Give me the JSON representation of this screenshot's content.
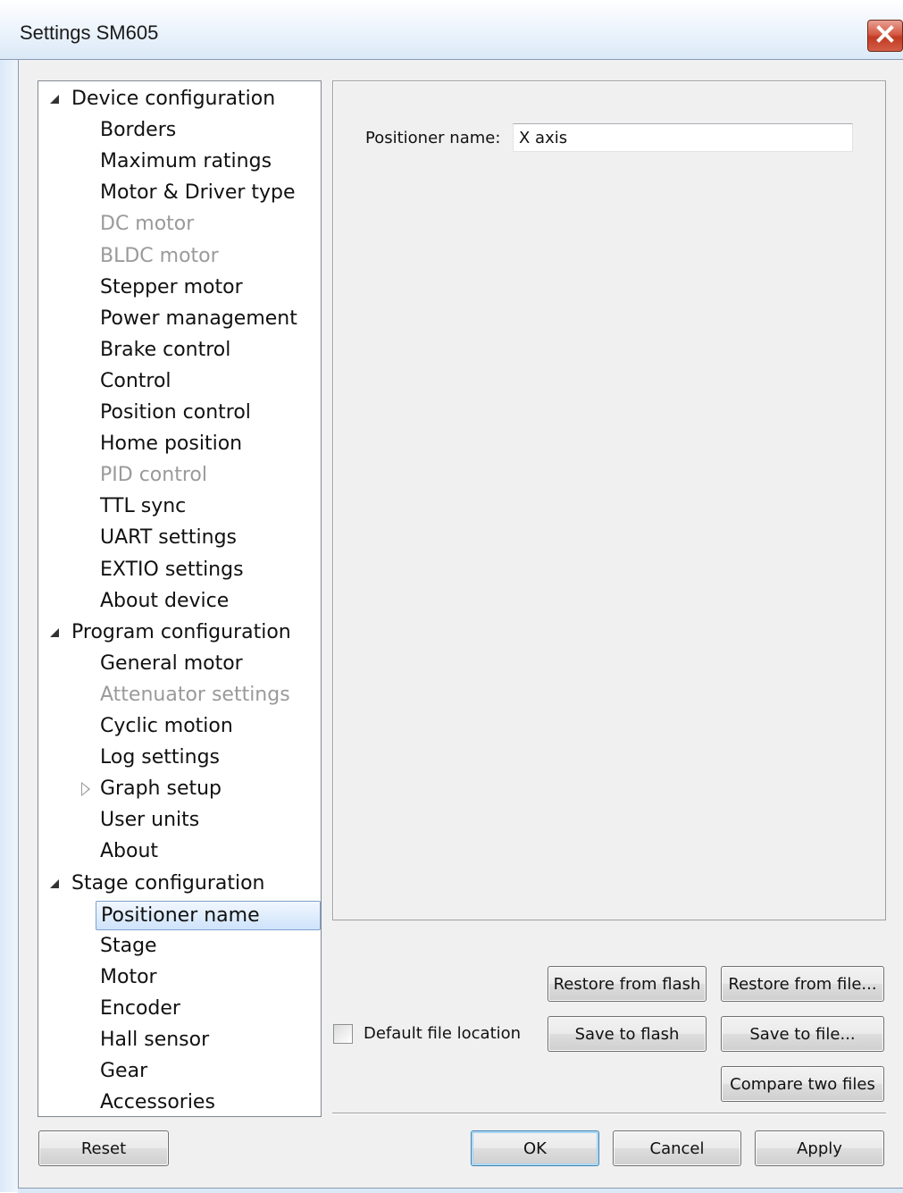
{
  "window": {
    "title": "Settings SM605",
    "close_icon": "close-icon"
  },
  "tree": {
    "groups": [
      {
        "label": "Device configuration",
        "expanded": true,
        "items": [
          {
            "label": "Borders",
            "enabled": true
          },
          {
            "label": "Maximum ratings",
            "enabled": true
          },
          {
            "label": "Motor & Driver type",
            "enabled": true
          },
          {
            "label": "DC motor",
            "enabled": false
          },
          {
            "label": "BLDC motor",
            "enabled": false
          },
          {
            "label": "Stepper motor",
            "enabled": true
          },
          {
            "label": "Power management",
            "enabled": true
          },
          {
            "label": "Brake control",
            "enabled": true
          },
          {
            "label": "Control",
            "enabled": true
          },
          {
            "label": "Position control",
            "enabled": true
          },
          {
            "label": "Home position",
            "enabled": true
          },
          {
            "label": "PID control",
            "enabled": false
          },
          {
            "label": "TTL sync",
            "enabled": true
          },
          {
            "label": "UART settings",
            "enabled": true
          },
          {
            "label": "EXTIO settings",
            "enabled": true
          },
          {
            "label": "About device",
            "enabled": true
          }
        ]
      },
      {
        "label": "Program configuration",
        "expanded": true,
        "items": [
          {
            "label": "General motor",
            "enabled": true
          },
          {
            "label": "Attenuator settings",
            "enabled": false
          },
          {
            "label": "Cyclic motion",
            "enabled": true
          },
          {
            "label": "Log settings",
            "enabled": true
          },
          {
            "label": "Graph setup",
            "enabled": true,
            "collapsed_children": true
          },
          {
            "label": "User units",
            "enabled": true
          },
          {
            "label": "About",
            "enabled": true
          }
        ]
      },
      {
        "label": "Stage configuration",
        "expanded": true,
        "items": [
          {
            "label": "Positioner name",
            "enabled": true,
            "selected": true
          },
          {
            "label": "Stage",
            "enabled": true
          },
          {
            "label": "Motor",
            "enabled": true
          },
          {
            "label": "Encoder",
            "enabled": true
          },
          {
            "label": "Hall sensor",
            "enabled": true
          },
          {
            "label": "Gear",
            "enabled": true
          },
          {
            "label": "Accessories",
            "enabled": true
          }
        ]
      }
    ]
  },
  "panel": {
    "positioner_label": "Positioner name:",
    "positioner_value": "X axis"
  },
  "file_actions": {
    "restore_from_flash": "Restore from flash",
    "restore_from_file": "Restore from file...",
    "save_to_flash": "Save to flash",
    "save_to_file": "Save to file...",
    "compare_two_files": "Compare two files",
    "default_location_label": "Default file location",
    "default_location_checked": false
  },
  "dialog_buttons": {
    "reset": "Reset",
    "ok": "OK",
    "cancel": "Cancel",
    "apply": "Apply"
  },
  "colors": {
    "selection_border": "#7da2ce",
    "disabled_text": "#9a9a9a",
    "close_button": "#c13a23"
  }
}
